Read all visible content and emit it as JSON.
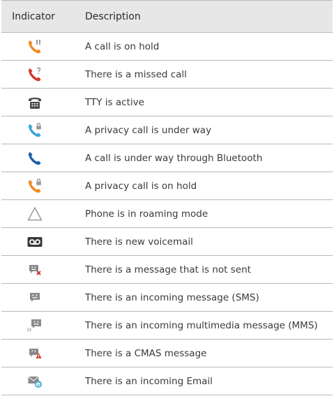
{
  "table": {
    "header": {
      "indicator": "Indicator",
      "description": "Description"
    },
    "rows": [
      {
        "icon": "call-on-hold-icon",
        "description": "A call is on hold"
      },
      {
        "icon": "missed-call-icon",
        "description": "There is a missed call"
      },
      {
        "icon": "tty-icon",
        "description": "TTY is active"
      },
      {
        "icon": "privacy-call-icon",
        "description": "A privacy call is under way"
      },
      {
        "icon": "bluetooth-call-icon",
        "description": "A call is under way through Bluetooth"
      },
      {
        "icon": "privacy-call-on-hold-icon",
        "description": "A privacy call is on hold"
      },
      {
        "icon": "roaming-icon",
        "description": "Phone is in roaming mode"
      },
      {
        "icon": "voicemail-icon",
        "description": "There is new voicemail"
      },
      {
        "icon": "message-not-sent-icon",
        "description": "There is a message that is not sent"
      },
      {
        "icon": "sms-icon",
        "description": "There is an incoming message (SMS)"
      },
      {
        "icon": "mms-icon",
        "description": "There is an incoming multimedia message (MMS)"
      },
      {
        "icon": "cmas-icon",
        "description": "There is a CMAS message"
      },
      {
        "icon": "email-icon",
        "description": "There is an incoming Email"
      }
    ]
  },
  "colors": {
    "orange": "#f08a1c",
    "red": "#d23a2a",
    "teal": "#3aa7d8",
    "blue": "#1f5ea8",
    "gray": "#8a8a8a",
    "dark": "#3a3a3a",
    "header_bg": "#e7e7e7",
    "rule": "#b8b8b8"
  }
}
